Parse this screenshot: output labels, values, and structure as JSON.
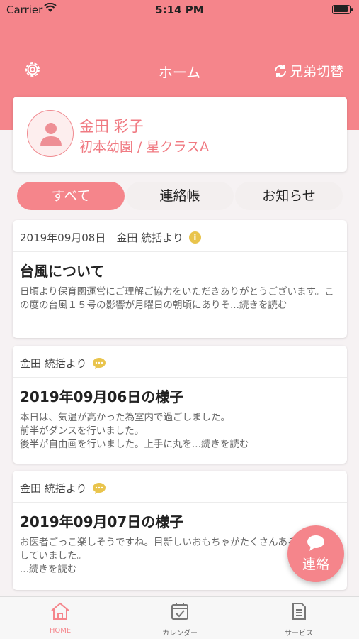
{
  "status_bar": {
    "carrier": "Carrier",
    "time": "5:14 PM"
  },
  "nav": {
    "title": "ホーム",
    "switch_label": "兄弟切替"
  },
  "profile": {
    "name": "金田 彩子",
    "school": "初本幼園 / 星クラスA"
  },
  "tabs": [
    {
      "label": "すべて",
      "active": true
    },
    {
      "label": "連絡帳",
      "active": false
    },
    {
      "label": "お知らせ",
      "active": false
    }
  ],
  "cards": [
    {
      "type": "notice",
      "meta": "2019年09月08日　金田 統括より",
      "title": "台風について",
      "body": "日頃より保育園運営にご理解ご協力をいただきありがとうございます。この度の台風１５号の影響が月曜日の朝頃にありそ...続きを読む"
    },
    {
      "type": "message",
      "meta": "金田 統括より",
      "title": "2019年09月06日の様子",
      "body": "本日は、気温が高かった為室内で過ごしました。\n前半がダンスを行いました。\n後半が自由画を行いました。上手に丸を...続きを読む"
    },
    {
      "type": "message",
      "meta": "金田 統括より",
      "title": "2019年09月07日の様子",
      "body": "お医者ごっこ楽しそうですね。目新しいおもちゃがたくさんあると通り出していました。\n...続きを読む"
    }
  ],
  "fab": {
    "label": "連絡"
  },
  "tabbar": [
    {
      "label": "HOME",
      "icon": "home-icon",
      "active": true
    },
    {
      "label": "カレンダー",
      "icon": "calendar-icon",
      "active": false
    },
    {
      "label": "サービス",
      "icon": "document-icon",
      "active": false
    }
  ],
  "colors": {
    "accent": "#f5858b",
    "name_text": "#f07a82",
    "info_badge": "#e9c44c"
  }
}
